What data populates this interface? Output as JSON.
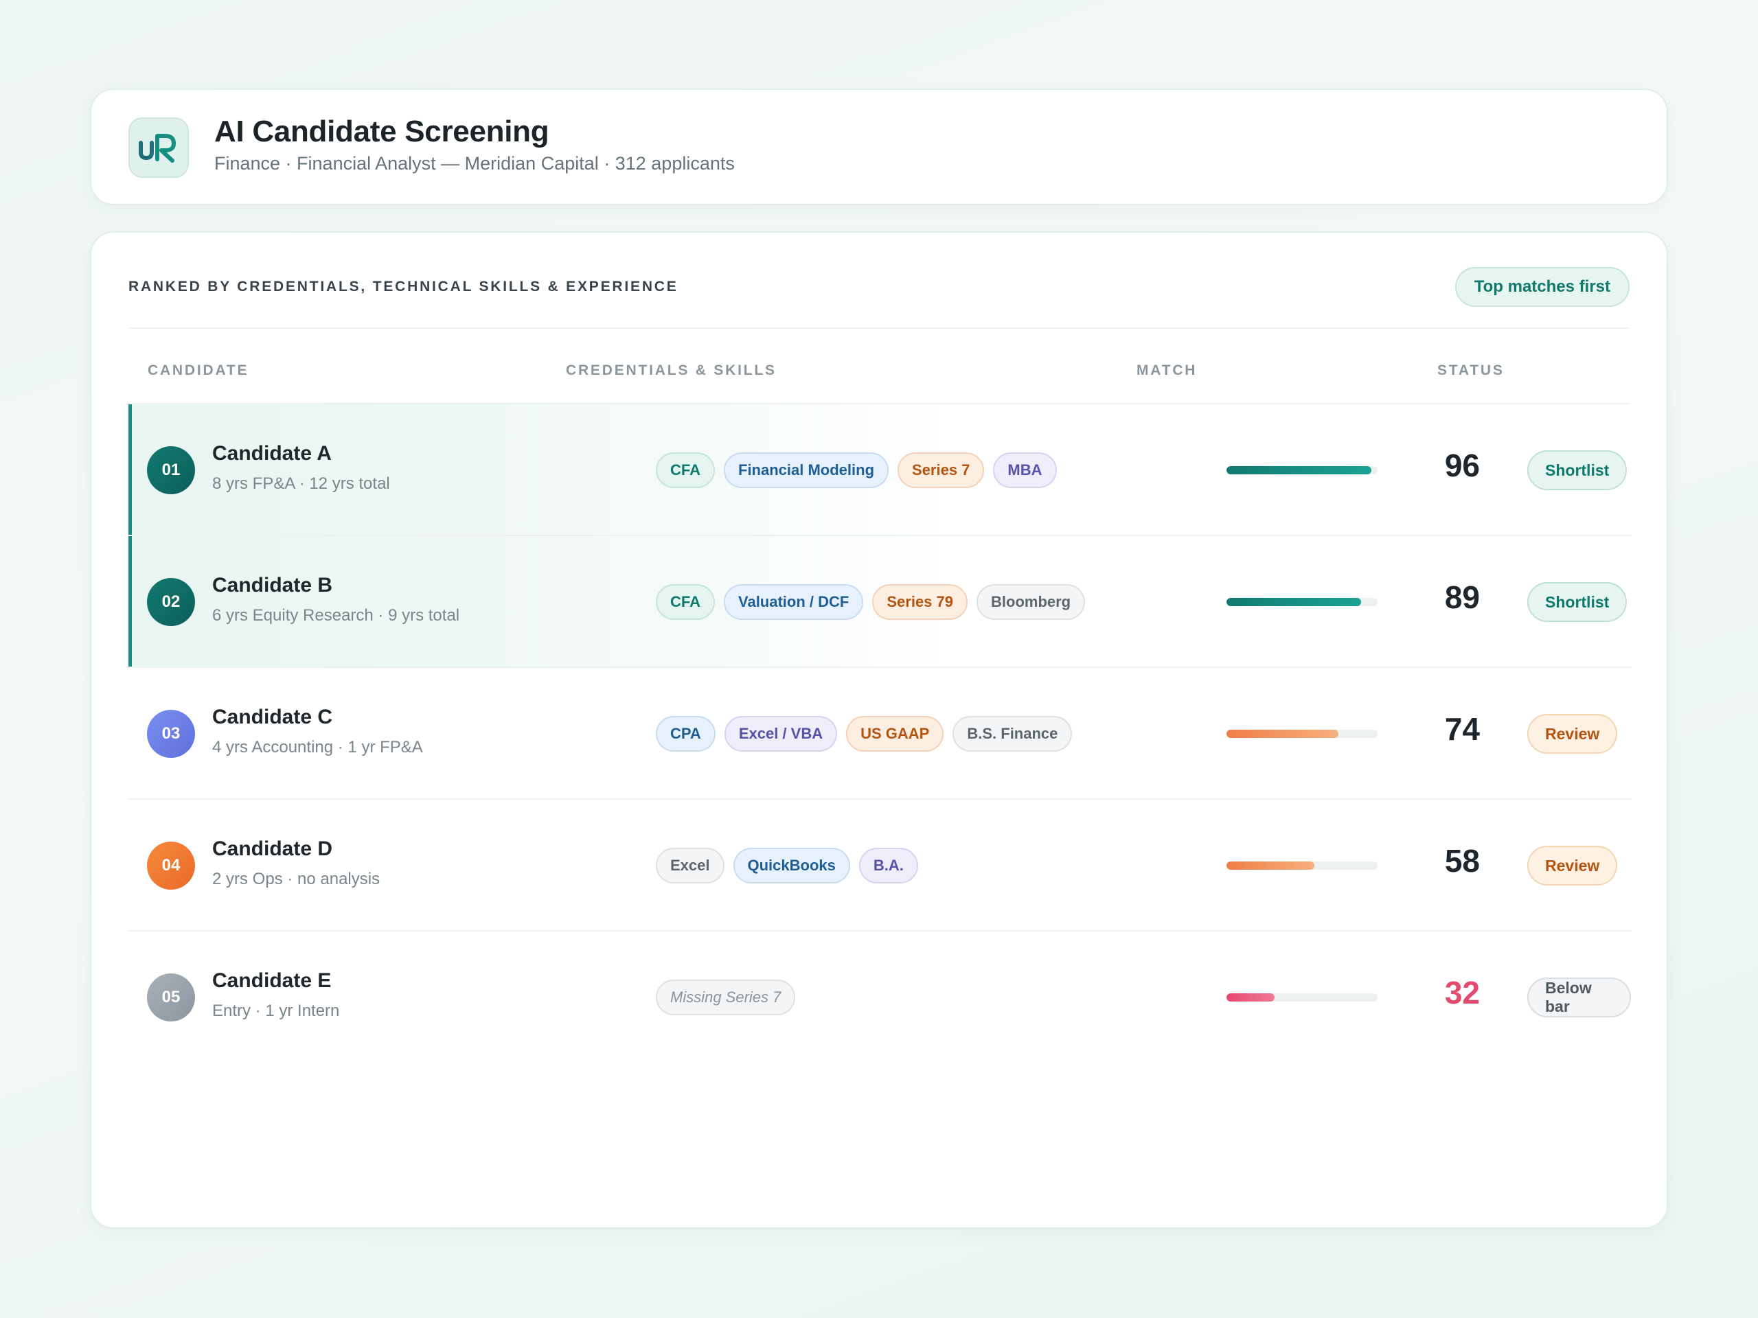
{
  "header": {
    "title": "AI Candidate Screening",
    "subtitle": "Finance · Financial Analyst — Meridian Capital · 312 applicants",
    "logo_text": "uR"
  },
  "panel": {
    "section_title": "RANKED BY CREDENTIALS, TECHNICAL SKILLS & EXPERIENCE",
    "sort_label": "Top matches first",
    "columns": [
      "CANDIDATE",
      "CREDENTIALS & SKILLS",
      "MATCH",
      "STATUS"
    ]
  },
  "colors": {
    "teal": "#178f80",
    "orange": "#f0894a",
    "pink": "#e34b6e"
  },
  "candidates": [
    {
      "rank": "01",
      "name": "Candidate A",
      "meta": "8 yrs FP&A · 12 yrs total",
      "skills": [
        {
          "label": "CFA",
          "tone": "teal"
        },
        {
          "label": "Financial Modeling",
          "tone": "blue"
        },
        {
          "label": "Series 7",
          "tone": "orange"
        },
        {
          "label": "MBA",
          "tone": "purple"
        }
      ],
      "match": 96,
      "match_text": "96",
      "status": "Shortlist",
      "status_tone": "shortlist"
    },
    {
      "rank": "02",
      "name": "Candidate B",
      "meta": "6 yrs Equity Research · 9 yrs total",
      "skills": [
        {
          "label": "CFA",
          "tone": "teal"
        },
        {
          "label": "Valuation / DCF",
          "tone": "blue"
        },
        {
          "label": "Series 79",
          "tone": "orange"
        },
        {
          "label": "Bloomberg",
          "tone": "gray"
        }
      ],
      "match": 89,
      "match_text": "89",
      "status": "Shortlist",
      "status_tone": "shortlist"
    },
    {
      "rank": "03",
      "name": "Candidate C",
      "meta": "4 yrs Accounting · 1 yr FP&A",
      "skills": [
        {
          "label": "CPA",
          "tone": "blue"
        },
        {
          "label": "Excel / VBA",
          "tone": "purple"
        },
        {
          "label": "US GAAP",
          "tone": "orange"
        },
        {
          "label": "B.S. Finance",
          "tone": "gray"
        }
      ],
      "match": 74,
      "match_text": "74",
      "status": "Review",
      "status_tone": "review"
    },
    {
      "rank": "04",
      "name": "Candidate D",
      "meta": "2 yrs Ops · no analysis",
      "skills": [
        {
          "label": "Excel",
          "tone": "gray"
        },
        {
          "label": "QuickBooks",
          "tone": "blue"
        },
        {
          "label": "B.A.",
          "tone": "purple"
        }
      ],
      "match": 58,
      "match_text": "58",
      "status": "Review",
      "status_tone": "review"
    },
    {
      "rank": "05",
      "name": "Candidate E",
      "meta": "Entry · 1 yr Intern",
      "skills": [
        {
          "label": "Missing Series 7",
          "tone": "missing"
        }
      ],
      "match": 32,
      "match_text": "32",
      "status": "Below bar",
      "status_tone": "below"
    }
  ]
}
